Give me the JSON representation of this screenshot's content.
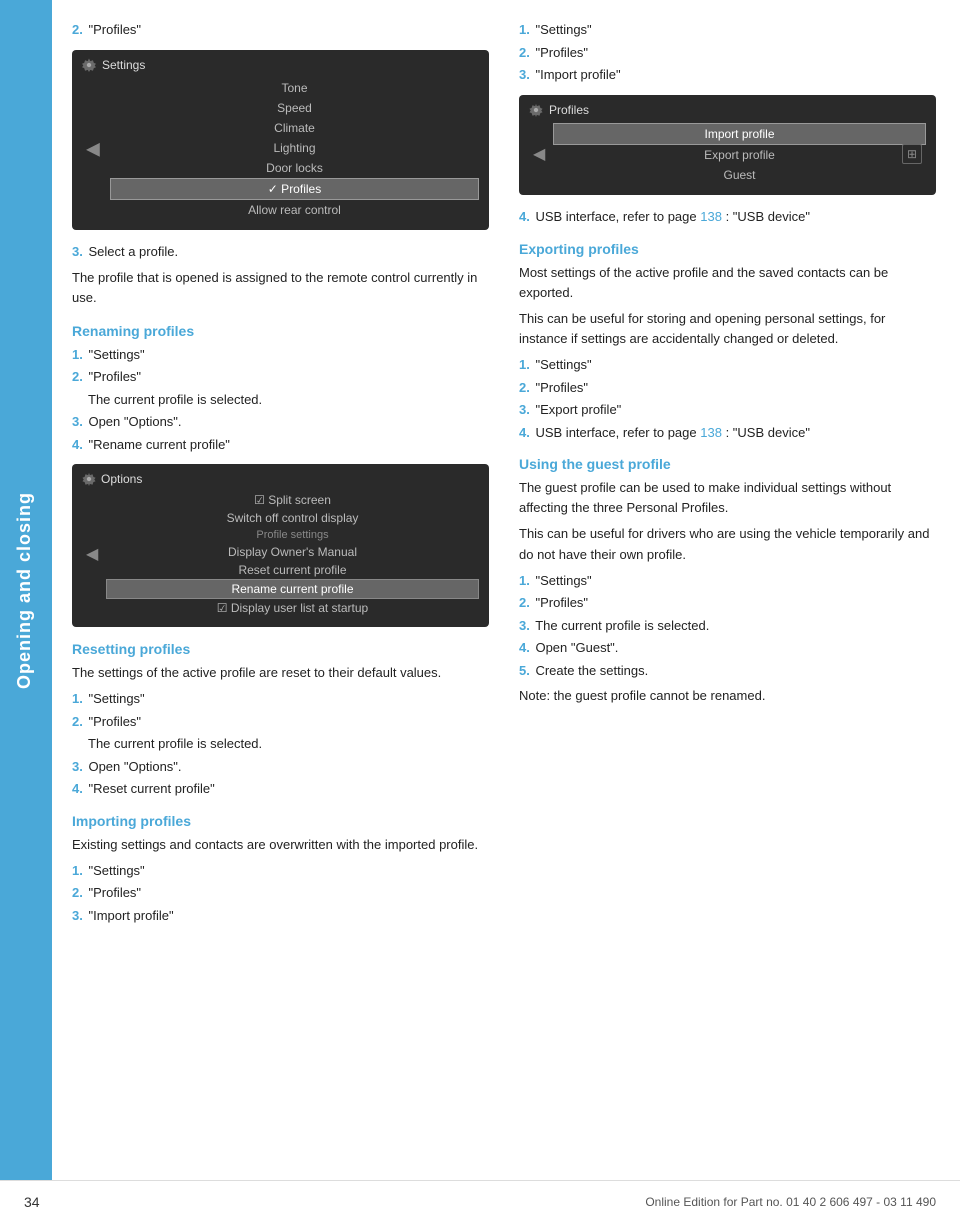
{
  "sidebar": {
    "label": "Opening and closing"
  },
  "page_number": "34",
  "footer_text": "Online Edition for Part no. 01 40 2 606 497 - 03 11 490",
  "left_column": {
    "intro_step": {
      "num": "2.",
      "label": "\"Profiles\""
    },
    "settings_screen": {
      "title": "Settings",
      "items": [
        "Tone",
        "Speed",
        "Climate",
        "Lighting",
        "Door locks",
        "Profiles",
        "Allow rear control"
      ],
      "selected": "Profiles"
    },
    "step3": "Select a profile.",
    "step3_desc": "The profile that is opened is assigned to the remote control currently in use.",
    "renaming": {
      "title": "Renaming profiles",
      "steps": [
        {
          "num": "1.",
          "text": "\"Settings\""
        },
        {
          "num": "2.",
          "text": "\"Profiles\""
        },
        {
          "indent": "The current profile is selected."
        },
        {
          "num": "3.",
          "text": "Open \"Options\"."
        },
        {
          "num": "4.",
          "text": "\"Rename current profile\""
        }
      ],
      "options_screen": {
        "title": "Options",
        "items": [
          {
            "label": "Split screen",
            "type": "checked"
          },
          {
            "label": "Switch off control display",
            "type": "normal"
          },
          {
            "label": "Profile settings",
            "type": "section"
          },
          {
            "label": "Display Owner's Manual",
            "type": "normal"
          },
          {
            "label": "Reset current profile",
            "type": "normal"
          },
          {
            "label": "Rename current profile",
            "type": "highlighted"
          },
          {
            "label": "Display user list at startup",
            "type": "checked"
          }
        ]
      }
    },
    "resetting": {
      "title": "Resetting profiles",
      "desc": "The settings of the active profile are reset to their default values.",
      "steps": [
        {
          "num": "1.",
          "text": "\"Settings\""
        },
        {
          "num": "2.",
          "text": "\"Profiles\""
        },
        {
          "indent": "The current profile is selected."
        },
        {
          "num": "3.",
          "text": "Open \"Options\"."
        },
        {
          "num": "4.",
          "text": "\"Reset current profile\""
        }
      ]
    },
    "importing": {
      "title": "Importing profiles",
      "desc": "Existing settings and contacts are overwritten with the imported profile.",
      "steps": [
        {
          "num": "1.",
          "text": "\"Settings\""
        },
        {
          "num": "2.",
          "text": "\"Profiles\""
        },
        {
          "num": "3.",
          "text": "\"Import profile\""
        }
      ]
    }
  },
  "right_column": {
    "import_screen": {
      "title": "Profiles",
      "items": [
        "Import profile",
        "Export profile",
        "Guest"
      ],
      "selected": "Import profile"
    },
    "import_step4": "USB interface, refer to page",
    "import_page_ref": "138",
    "import_step4_suffix": ": \"USB device\"",
    "exporting": {
      "title": "Exporting profiles",
      "desc1": "Most settings of the active profile and the saved contacts can be exported.",
      "desc2": "This can be useful for storing and opening personal settings, for instance if settings are accidentally changed or deleted.",
      "steps": [
        {
          "num": "1.",
          "text": "\"Settings\""
        },
        {
          "num": "2.",
          "text": "\"Profiles\""
        },
        {
          "num": "3.",
          "text": "\"Export profile\""
        },
        {
          "num": "4.",
          "text": "USB interface, refer to page",
          "ref": "138",
          "suffix": ": \"USB device\""
        }
      ]
    },
    "guest": {
      "title": "Using the guest profile",
      "desc1": "The guest profile can be used to make individual settings without affecting the three Personal Profiles.",
      "desc2": "This can be useful for drivers who are using the vehicle temporarily and do not have their own profile.",
      "steps": [
        {
          "num": "1.",
          "text": "\"Settings\""
        },
        {
          "num": "2.",
          "text": "\"Profiles\""
        },
        {
          "num": "3.",
          "text": "The current profile is selected."
        },
        {
          "num": "4.",
          "text": "Open \"Guest\"."
        },
        {
          "num": "5.",
          "text": "Create the settings."
        }
      ],
      "note": "Note: the guest profile cannot be renamed."
    }
  }
}
